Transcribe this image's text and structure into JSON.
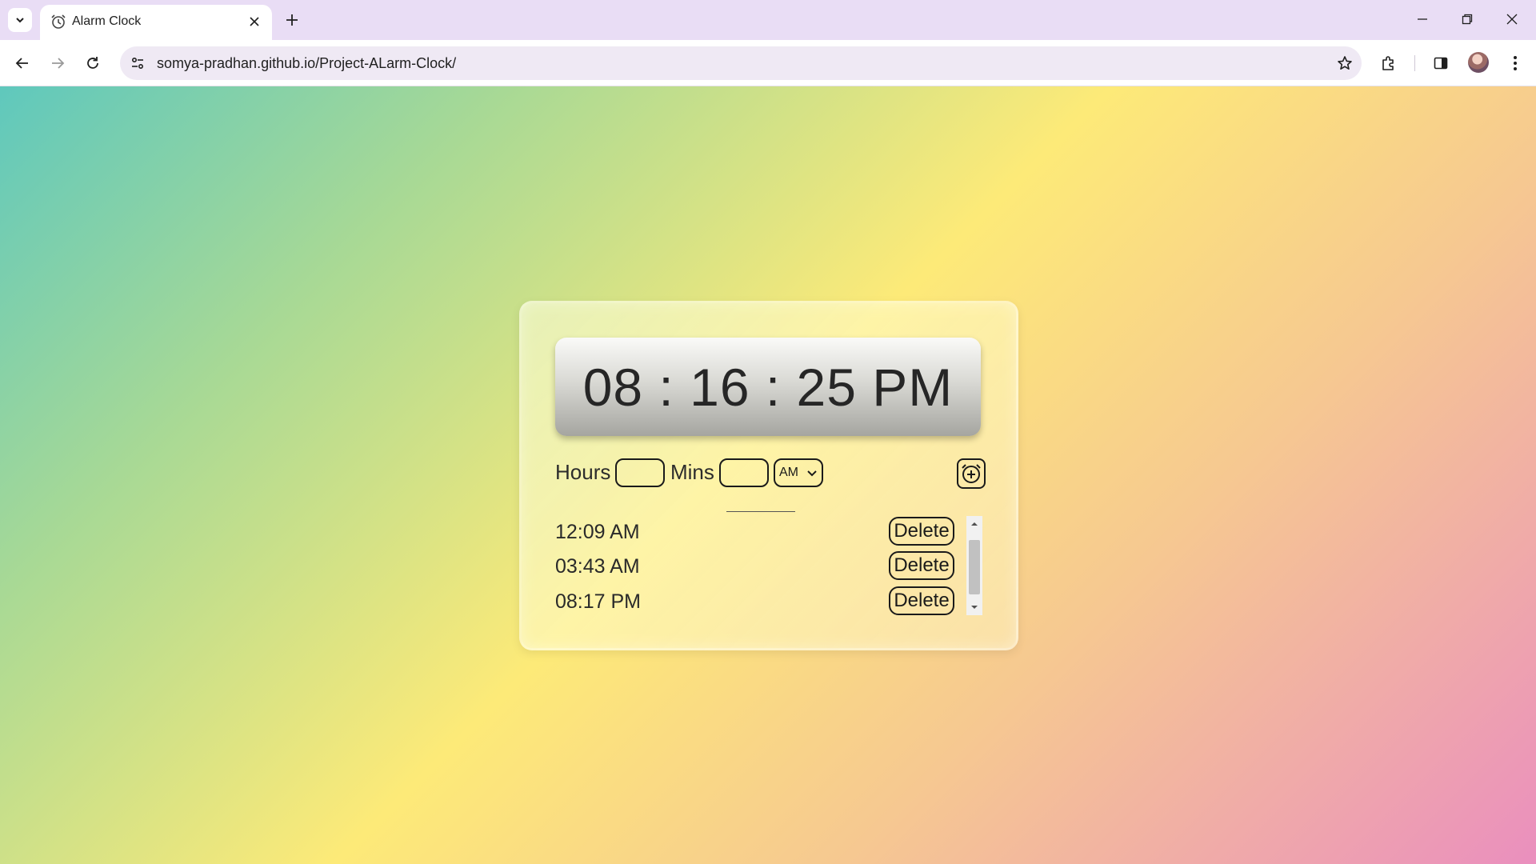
{
  "browser": {
    "tab": {
      "title": "Alarm Clock",
      "icon": "alarm-clock-icon"
    },
    "url": "somya-pradhan.github.io/Project-ALarm-Clock/"
  },
  "clock": {
    "display": "08 : 16 : 25 PM"
  },
  "form": {
    "hours_label": "Hours",
    "mins_label": "Mins",
    "hours_value": "",
    "mins_value": "",
    "meridiem_selected": "AM",
    "add_icon": "add-alarm-icon"
  },
  "alarms": [
    {
      "time": "12:09 AM",
      "delete_label": "Delete"
    },
    {
      "time": "03:43 AM",
      "delete_label": "Delete"
    },
    {
      "time": "08:17 PM",
      "delete_label": "Delete"
    }
  ],
  "colors": {
    "gradient": [
      "#5fc8bd",
      "#a8d995",
      "#fdea78",
      "#f6c891",
      "#ea8fbe"
    ],
    "tabbar": "#e9ddf5"
  }
}
